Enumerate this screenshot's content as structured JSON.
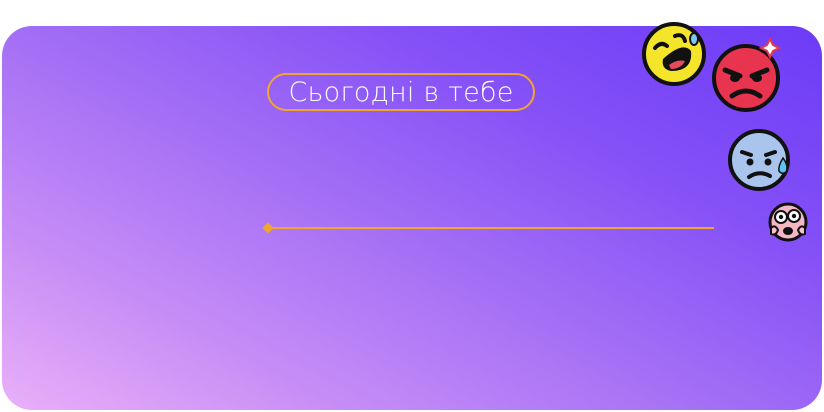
{
  "card": {
    "title": "Сьогодні в тебе"
  },
  "mood_slider": {
    "value": 0
  },
  "emojis": [
    {
      "icon": "laughing-face-icon"
    },
    {
      "icon": "angry-face-icon"
    },
    {
      "icon": "sad-sweat-face-icon"
    },
    {
      "icon": "scared-face-icon"
    }
  ],
  "colors": {
    "accent": "#f0a531",
    "gradient_start": "#e9b0f8",
    "gradient_end": "#6c3bf7",
    "text": "#ffffff"
  }
}
